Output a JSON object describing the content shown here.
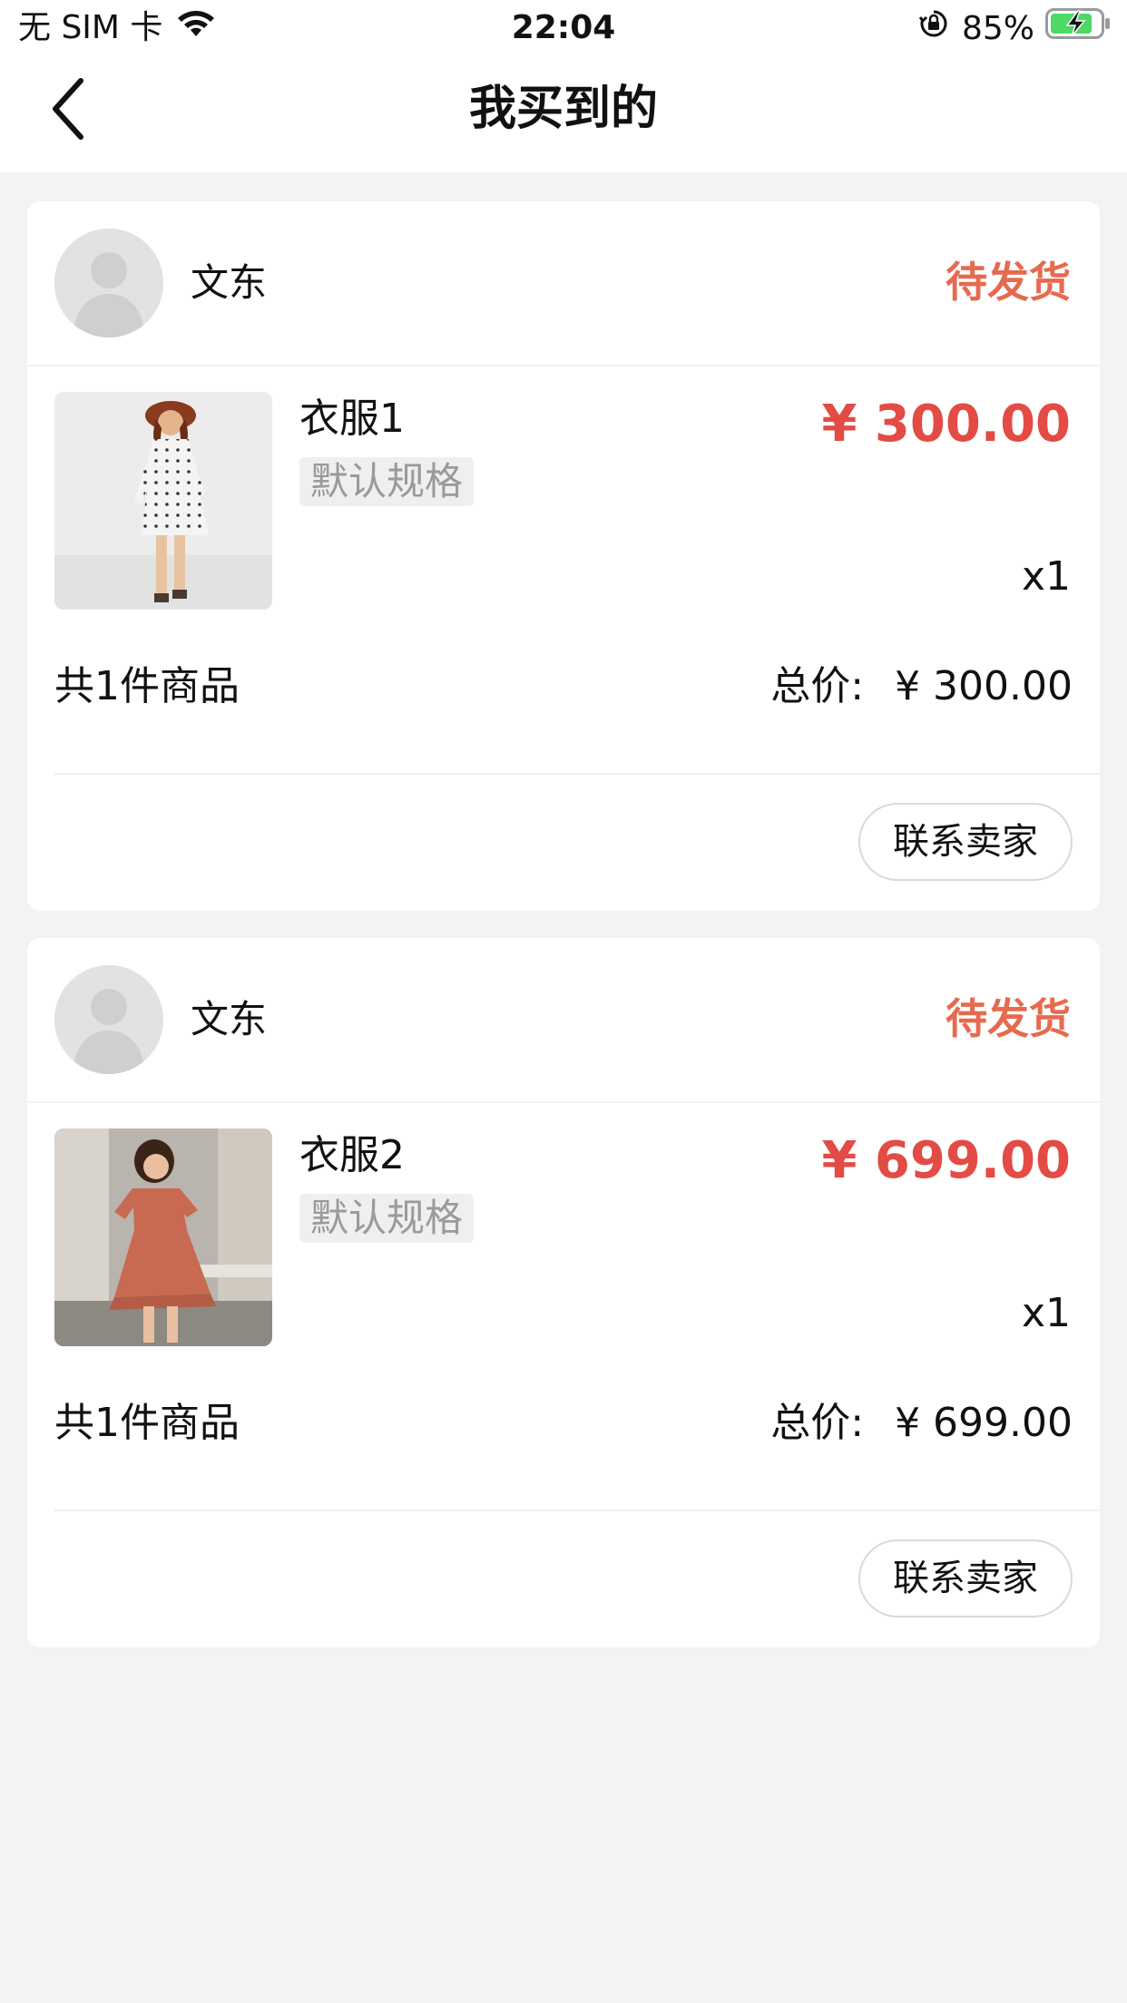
{
  "status_bar": {
    "carrier": "无 SIM 卡",
    "time": "22:04",
    "battery_percent": "85%",
    "battery_level": 0.85,
    "icons": [
      "wifi-icon",
      "orientation-lock-icon",
      "battery-charging-icon"
    ]
  },
  "nav": {
    "title": "我买到的",
    "back_icon": "chevron-left-icon"
  },
  "colors": {
    "status_accent": "#e66a4f",
    "price_red": "#e34b45",
    "page_background": "#f3f3f3"
  },
  "orders": [
    {
      "seller_name": "文东",
      "status": "待发货",
      "product_name": "衣服1",
      "spec": "默认规格",
      "price": "¥ 300.00",
      "quantity": "x1",
      "item_count": "共1件商品",
      "total_label": "总价:",
      "total_value": "¥ 300.00",
      "contact_label": "联系卖家"
    },
    {
      "seller_name": "文东",
      "status": "待发货",
      "product_name": "衣服2",
      "spec": "默认规格",
      "price": "¥ 699.00",
      "quantity": "x1",
      "item_count": "共1件商品",
      "total_label": "总价:",
      "total_value": "¥ 699.00",
      "contact_label": "联系卖家"
    }
  ]
}
